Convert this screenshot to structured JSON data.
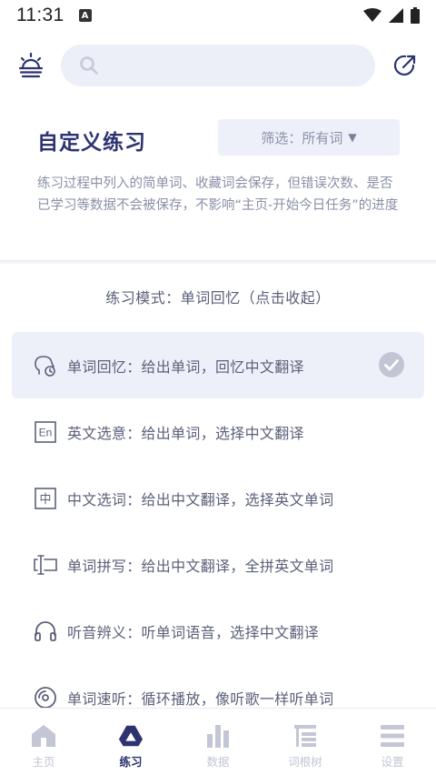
{
  "status_bar": {
    "time": "11:31",
    "notification_badge": "A",
    "icons": [
      "wifi-icon",
      "signal-icon",
      "battery-icon"
    ]
  },
  "header": {
    "left_icon": "sun-horizon-icon",
    "search_placeholder": "",
    "search_value": "",
    "right_icon": "external-link-icon"
  },
  "title": "自定义练习",
  "filter": {
    "label": "筛选：所有词",
    "arrow": "▼"
  },
  "description": "练习过程中列入的简单词、收藏词会保存，但错误次数、是否已学习等数据不会被保存，不影响“主页-开始今日任务”的进度",
  "mode_header": "练习模式：单词回忆（点击收起）",
  "modes": [
    {
      "label": "单词回忆：给出单词，回忆中文翻译",
      "icon": "head-clock-icon",
      "selected": true
    },
    {
      "label": "英文选意：给出单词，选择中文翻译",
      "icon": "en-icon",
      "icon_text": "En",
      "selected": false
    },
    {
      "label": "中文选词：给出中文翻译，选择英文单词",
      "icon": "zhong-icon",
      "icon_text": "中",
      "selected": false
    },
    {
      "label": "单词拼写：给出中文翻译，全拼英文单词",
      "icon": "text-cursor-icon",
      "selected": false
    },
    {
      "label": "听音辨义：听单词语音，选择中文翻译",
      "icon": "headphones-icon",
      "selected": false
    },
    {
      "label": "单词速听：循环播放，像听歌一样听单词",
      "icon": "disc-icon",
      "selected": false
    }
  ],
  "nav": [
    {
      "label": "主页",
      "icon": "home-icon",
      "active": false
    },
    {
      "label": "练习",
      "icon": "triangle-icon",
      "active": true
    },
    {
      "label": "数据",
      "icon": "bar-chart-icon",
      "active": false
    },
    {
      "label": "词根树",
      "icon": "tree-icon",
      "active": false
    },
    {
      "label": "设置",
      "icon": "menu-icon",
      "active": false
    }
  ],
  "colors": {
    "primary": "#2d3370",
    "text": "#5c6079",
    "muted": "#8a8fa6",
    "selected_bg": "#eef0f9",
    "search_bg": "#eceef8",
    "nav_inactive": "#c3c6d4"
  }
}
